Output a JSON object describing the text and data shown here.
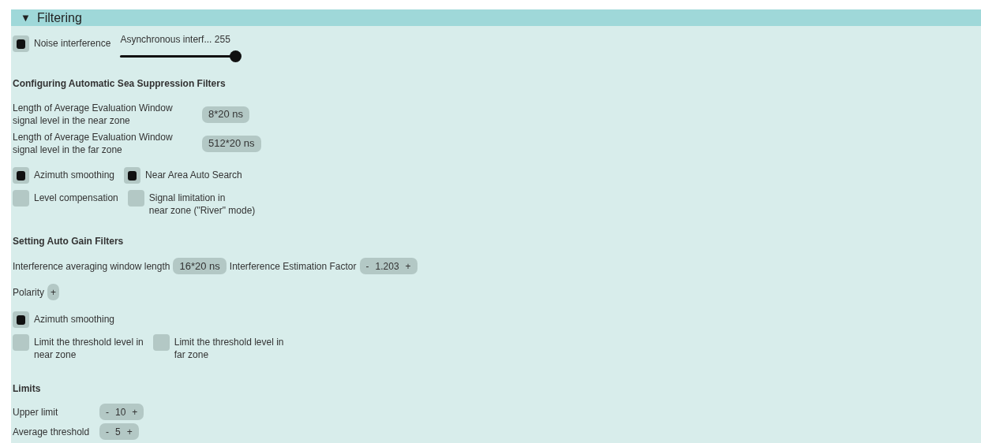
{
  "panel": {
    "arrow": "▼",
    "title": "Filtering",
    "expanded": true
  },
  "noise": {
    "checkbox": {
      "label": [
        "Noise interference"
      ],
      "checked": true
    },
    "slider": {
      "label": "Asynchronous interf...",
      "value": "255",
      "level": 1
    }
  },
  "sea": {
    "heading": "Configuring Automatic Sea Suppression Filters",
    "windows": [
      {
        "label": [
          "Length of Average Evaluation Window",
          "signal level in the near zone"
        ],
        "value": "8*20 ns"
      },
      {
        "label": [
          "Length of Average Evaluation Window",
          "signal level in the far zone"
        ],
        "value": "512*20 ns"
      }
    ],
    "checkbox_rows": [
      [
        {
          "label": [
            "Azimuth smoothing"
          ],
          "checked": true
        },
        {
          "label": [
            "Near Area Auto Search"
          ],
          "checked": true
        }
      ],
      [
        {
          "label": [
            "Level compensation"
          ],
          "checked": false
        },
        {
          "label": [
            "Signal limitation in",
            "near zone (\"River\" mode)"
          ],
          "checked": false
        }
      ]
    ]
  },
  "gain": {
    "heading": "Setting Auto Gain Filters",
    "window_label": "Interference averaging window length",
    "window_value": "16*20 ns",
    "factor": {
      "label": "Interference Estimation Factor",
      "minus": "-",
      "value": "1.203",
      "plus": "+"
    },
    "polarity": {
      "label": "Polarity",
      "value": "+"
    },
    "checkbox_rows": [
      [
        {
          "label": [
            "Azimuth smoothing"
          ],
          "checked": true
        }
      ],
      [
        {
          "label": [
            "Limit the threshold level in",
            "near zone"
          ],
          "checked": false
        },
        {
          "label": [
            "Limit the threshold level in",
            "far zone"
          ],
          "checked": false
        }
      ]
    ]
  },
  "limits": {
    "heading": "Limits",
    "rows": [
      {
        "label": "Upper limit",
        "minus": "-",
        "value": "10",
        "plus": "+"
      },
      {
        "label": "Average threshold",
        "minus": "-",
        "value": "5",
        "plus": "+"
      }
    ]
  }
}
